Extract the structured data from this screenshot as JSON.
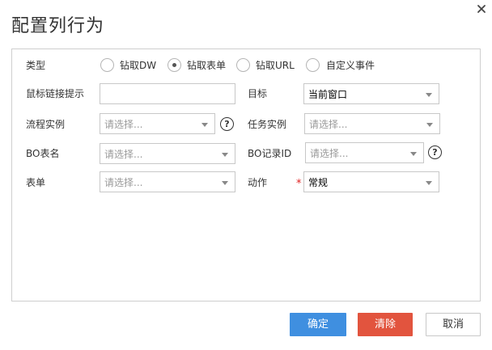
{
  "dialog": {
    "title": "配置列行为"
  },
  "type_row": {
    "label": "类型",
    "options": [
      {
        "label": "钻取DW",
        "checked": false
      },
      {
        "label": "钻取表单",
        "checked": true
      },
      {
        "label": "钻取URL",
        "checked": false
      },
      {
        "label": "自定义事件",
        "checked": false
      }
    ]
  },
  "fields": {
    "mouse_tip": {
      "label": "鼠标链接提示",
      "value": ""
    },
    "target": {
      "label": "目标",
      "value": "当前窗口"
    },
    "process_instance": {
      "label": "流程实例",
      "placeholder": "请选择..."
    },
    "task_instance": {
      "label": "任务实例",
      "placeholder": "请选择..."
    },
    "bo_table": {
      "label": "BO表名",
      "placeholder": "请选择..."
    },
    "bo_record_id": {
      "label": "BO记录ID",
      "placeholder": "请选择..."
    },
    "form": {
      "label": "表单",
      "placeholder": "请选择..."
    },
    "action": {
      "label": "动作",
      "required_mark": "*",
      "value": "常规"
    }
  },
  "help": {
    "glyph": "?"
  },
  "buttons": {
    "confirm": "确定",
    "clear": "清除",
    "cancel": "取消"
  }
}
